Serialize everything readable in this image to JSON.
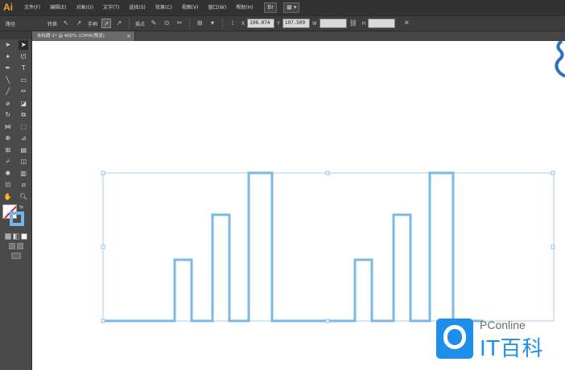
{
  "app": {
    "logo": "Ai"
  },
  "menubar": {
    "items": [
      "文件(F)",
      "编辑(E)",
      "对象(O)",
      "文字(T)",
      "选择(S)",
      "效果(C)",
      "视图(V)",
      "窗口(W)",
      "帮助(H)"
    ],
    "bridge": "Br",
    "workspace": "▦ ▾"
  },
  "controlbar": {
    "selection_label": "路径",
    "anchor_label": "转换",
    "handle_label": "手柄",
    "anchor_point_label": "描点",
    "x_label": "X",
    "x_value": "198.074",
    "y_label": "Y",
    "y_value": "107.509",
    "w_label": "W",
    "h_label": "H"
  },
  "document": {
    "tab_title": "未标题-1* @ 400% (CMYK/预览)",
    "tab_close": "×"
  },
  "colors": {
    "stroke": "#6fb7ee",
    "fill": "none",
    "bounding_box": "#9fcaf0"
  },
  "artwork": {
    "description_pattern": "stepped-bar outline",
    "bar_heights_relative": [
      0.42,
      0.72,
      1.0
    ],
    "repeats": 2
  },
  "watermark": {
    "brand": "PConline",
    "product": "IT百科"
  }
}
